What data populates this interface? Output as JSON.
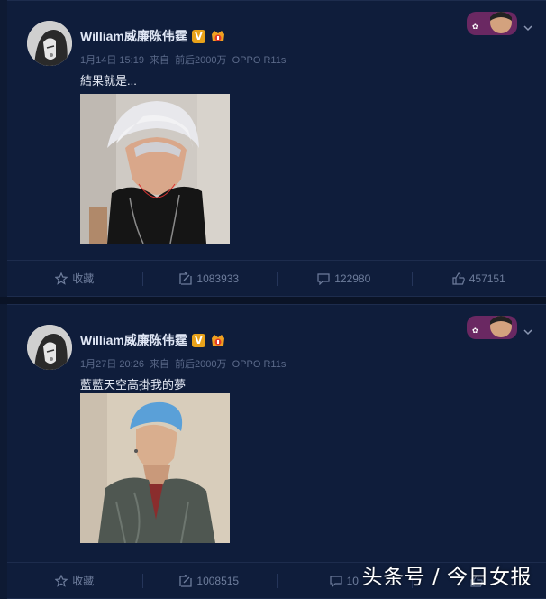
{
  "posts": [
    {
      "author": "William威廉陈伟霆",
      "verified_mark": "V",
      "time": "1月14日 15:19",
      "source_prefix": "来自",
      "source_a": "前后2000万",
      "source_b": "OPPO R11s",
      "text": "結果就是...",
      "actions": {
        "favorite": "收藏",
        "repost": "1083933",
        "comment": "122980",
        "like": "457151"
      }
    },
    {
      "author": "William威廉陈伟霆",
      "verified_mark": "V",
      "time": "1月27日 20:26",
      "source_prefix": "来自",
      "source_a": "前后2000万",
      "source_b": "OPPO R11s",
      "text": "藍藍天空高掛我的夢",
      "actions": {
        "favorite": "收藏",
        "repost": "1008515",
        "comment": "10"
      }
    }
  ],
  "watermark": "头条号 / 今日女报",
  "colors": {
    "background": "#0e1a33",
    "card": "#0f1d3b",
    "verified": "#e8a21a"
  }
}
